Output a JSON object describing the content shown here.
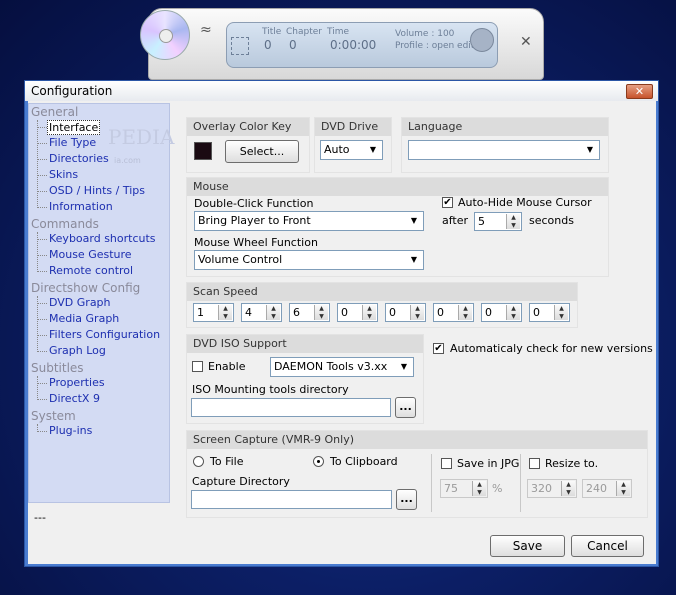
{
  "player": {
    "lcd": {
      "title_label": "Title",
      "chapter_label": "Chapter",
      "time_label": "Time",
      "title_value": "0",
      "chapter_value": "0",
      "time_value": "0:00:00",
      "volume_text": "Volume : 100",
      "profile_text": "Profile : open edit"
    },
    "close_glyph": "✕",
    "wave_glyph": "≈"
  },
  "window": {
    "title": "Configuration",
    "close_glyph": "✕"
  },
  "tree": {
    "groups": [
      {
        "label": "General",
        "items": [
          "Interface",
          "File Type",
          "Directories",
          "Skins",
          "OSD / Hints / Tips",
          "Information"
        ]
      },
      {
        "label": "Commands",
        "items": [
          "Keyboard shortcuts",
          "Mouse Gesture",
          "Remote control"
        ]
      },
      {
        "label": "Directshow Config",
        "items": [
          "DVD Graph",
          "Media Graph",
          "Filters Configuration",
          "Graph Log"
        ]
      },
      {
        "label": "Subtitles",
        "items": [
          "Properties",
          "DirectX 9"
        ]
      },
      {
        "label": "System",
        "items": [
          "Plug-ins"
        ]
      }
    ],
    "watermark": "PEDIA",
    "watermark_small": "ia.com"
  },
  "status_text": "---",
  "overlay": {
    "header": "Overlay Color Key",
    "select_label": "Select...",
    "color": "#1a0a12"
  },
  "dvd_drive": {
    "header": "DVD Drive",
    "value": "Auto"
  },
  "language": {
    "header": "Language",
    "value": ""
  },
  "mouse": {
    "header": "Mouse",
    "dbl_click_label": "Double-Click Function",
    "dbl_click_value": "Bring Player to Front",
    "wheel_label": "Mouse Wheel Function",
    "wheel_value": "Volume Control",
    "autohide_label": "Auto-Hide Mouse Cursor",
    "after_label": "after",
    "after_value": "5",
    "seconds_label": "seconds"
  },
  "scan_speed": {
    "header": "Scan Speed",
    "values": [
      "1",
      "4",
      "6",
      "0",
      "0",
      "0",
      "0",
      "0"
    ]
  },
  "iso": {
    "header": "DVD ISO Support",
    "enable_label": "Enable",
    "tool_value": "DAEMON Tools v3.xx",
    "dir_label": "ISO Mounting tools directory",
    "dir_value": "",
    "browse_label": "..."
  },
  "auto_check_label": "Automaticaly check for new versions",
  "capture": {
    "header": "Screen Capture (VMR-9 Only)",
    "to_file_label": "To File",
    "to_clipboard_label": "To Clipboard",
    "dir_label": "Capture Directory",
    "dir_value": "",
    "browse_label": "...",
    "save_jpg_label": "Save in JPG",
    "jpg_quality": "75",
    "percent_label": "%",
    "resize_label": "Resize to.",
    "resize_w": "320",
    "resize_h": "240"
  },
  "buttons": {
    "save": "Save",
    "cancel": "Cancel"
  },
  "glyphs": {
    "dd": "▼",
    "up": "▲",
    "down": "▼",
    "check": "✔"
  }
}
